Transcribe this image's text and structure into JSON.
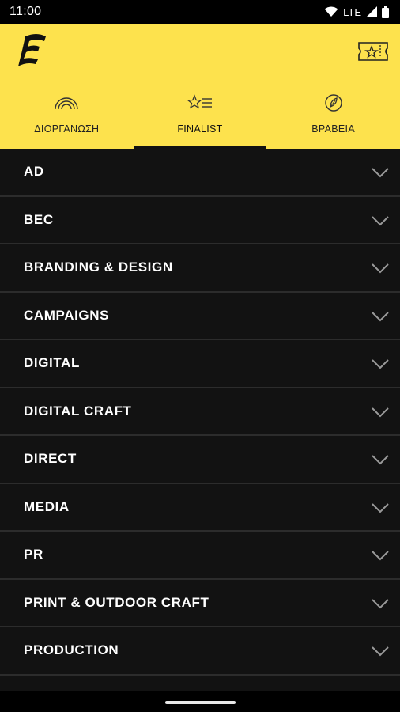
{
  "status_bar": {
    "time": "11:00",
    "network": "LTE"
  },
  "header": {
    "logo_icon": "e-logo-icon",
    "ticket_icon": "ticket-star-icon",
    "tabs": [
      {
        "label": "ΔΙΟΡΓΑΝΩΣΗ",
        "icon": "rainbow-icon",
        "active": false
      },
      {
        "label": "FINALIST",
        "icon": "star-list-icon",
        "active": true
      },
      {
        "label": "ΒΡΑΒΕΙΑ",
        "icon": "leaf-medal-icon",
        "active": false
      }
    ]
  },
  "categories": [
    "AD",
    "BEC",
    "BRANDING & DESIGN",
    "CAMPAIGNS",
    "DIGITAL",
    "DIGITAL CRAFT",
    "DIRECT",
    "MEDIA",
    "PR",
    "PRINT & OUTDOOR CRAFT",
    "PRODUCTION"
  ],
  "colors": {
    "accent": "#fde24d",
    "list_background": "#121212",
    "row_text": "#ffffff"
  }
}
